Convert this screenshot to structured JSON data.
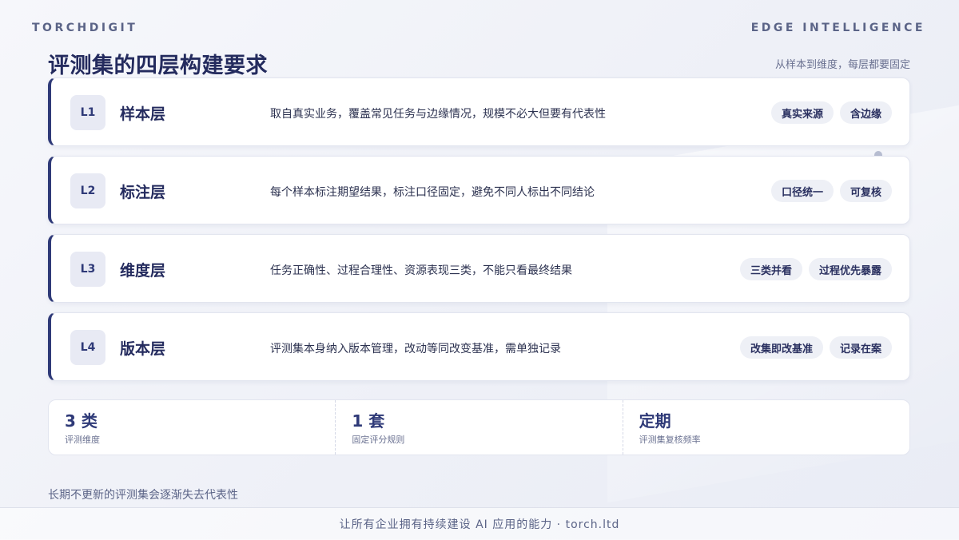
{
  "brand": {
    "left": "TORCHDIGIT",
    "right": "EDGE INTELLIGENCE"
  },
  "title": "评测集的四层构建要求",
  "subtitle": "从样本到维度，每层都要固定",
  "layers": [
    {
      "code": "L1",
      "name": "样本层",
      "desc": "取自真实业务，覆盖常见任务与边缘情况，规模不必大但要有代表性",
      "tags": [
        "真实来源",
        "含边缘"
      ]
    },
    {
      "code": "L2",
      "name": "标注层",
      "desc": "每个样本标注期望结果，标注口径固定，避免不同人标出不同结论",
      "tags": [
        "口径统一",
        "可复核"
      ]
    },
    {
      "code": "L3",
      "name": "维度层",
      "desc": "任务正确性、过程合理性、资源表现三类，不能只看最终结果",
      "tags": [
        "三类并看",
        "过程优先暴露"
      ]
    },
    {
      "code": "L4",
      "name": "版本层",
      "desc": "评测集本身纳入版本管理，改动等同改变基准，需单独记录",
      "tags": [
        "改集即改基准",
        "记录在案"
      ]
    }
  ],
  "stats": [
    {
      "value": "3 类",
      "label": "评测维度"
    },
    {
      "value": "1 套",
      "label": "固定评分规则"
    },
    {
      "value": "定期",
      "label": "评测集复核频率"
    }
  ],
  "footnote": "长期不更新的评测集会逐渐失去代表性",
  "footer": "让所有企业拥有持续建设 AI 应用的能力 · torch.ltd"
}
